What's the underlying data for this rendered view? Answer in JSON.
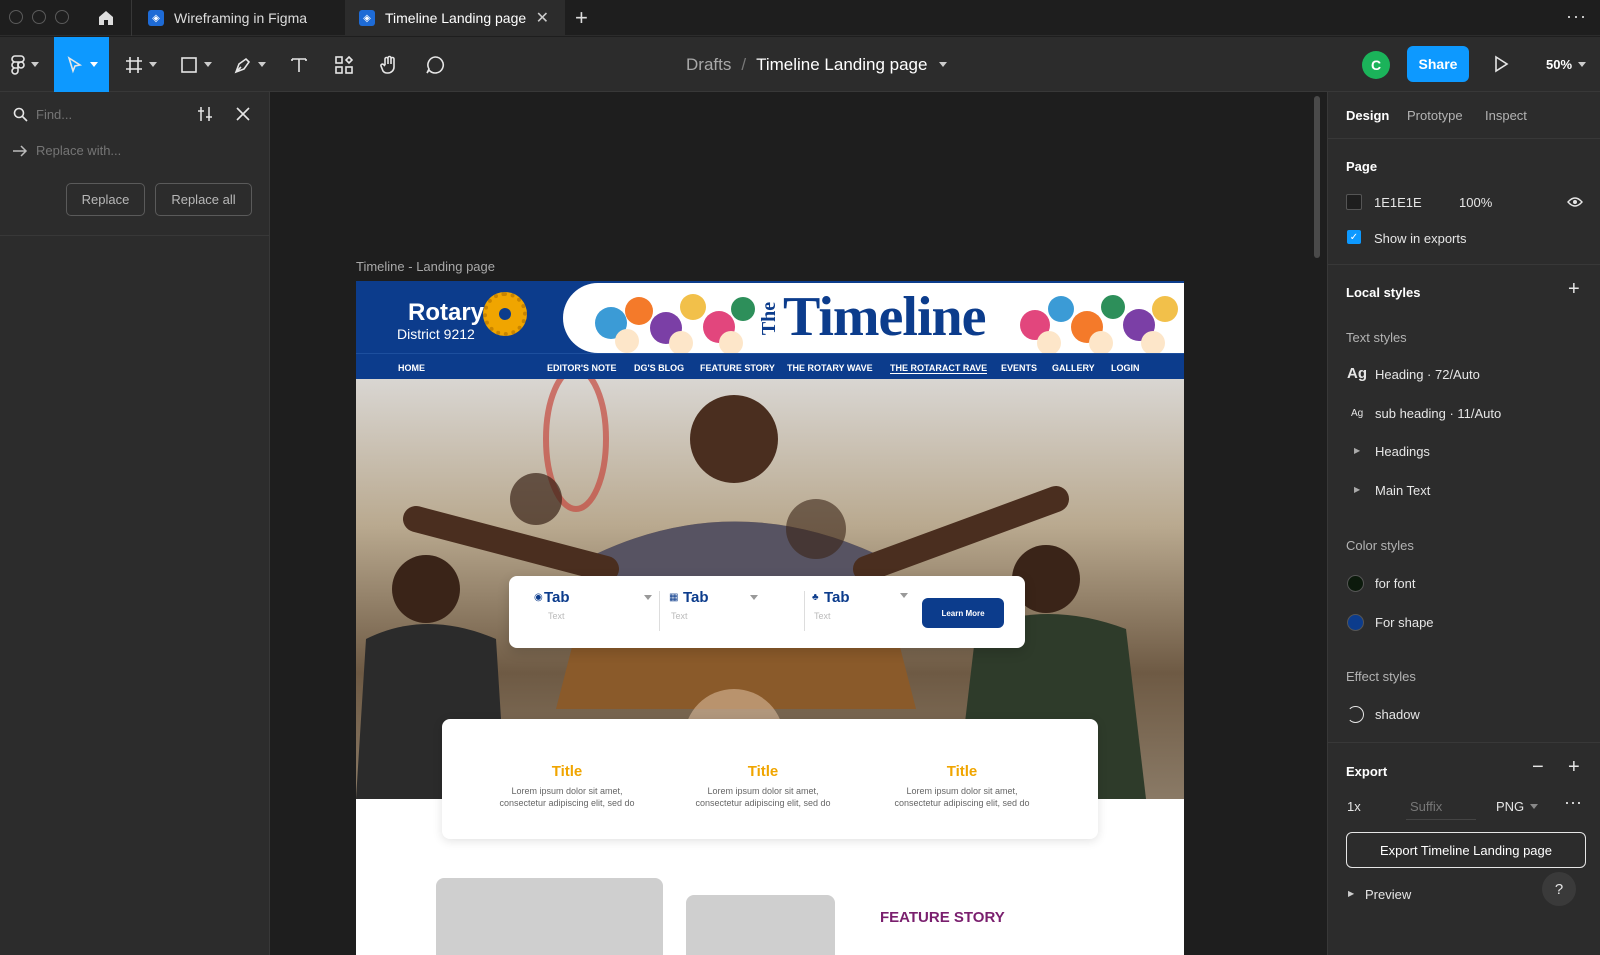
{
  "tabs": [
    {
      "label": "Wireframing in Figma"
    },
    {
      "label": "Timeline Landing page"
    }
  ],
  "toolbar": {
    "breadcrumb_root": "Drafts",
    "breadcrumb_sep": "/",
    "file_name": "Timeline Landing page",
    "avatar_initial": "C",
    "share_label": "Share",
    "zoom": "50%"
  },
  "find": {
    "find_placeholder": "Find...",
    "replace_placeholder": "Replace with...",
    "replace_label": "Replace",
    "replace_all_label": "Replace all"
  },
  "right": {
    "tabs": [
      "Design",
      "Prototype",
      "Inspect"
    ],
    "page_heading": "Page",
    "page_color": "1E1E1E",
    "page_opacity": "100%",
    "show_exports": "Show in exports",
    "local_styles": "Local styles",
    "text_styles": "Text styles",
    "text_items": [
      {
        "icon": "Ag",
        "name": "Heading · 72/Auto"
      },
      {
        "icon": "Ag",
        "name": "sub heading · 11/Auto"
      }
    ],
    "groups": [
      "Headings",
      "Main Text"
    ],
    "color_styles": "Color styles",
    "colors": [
      {
        "name": "for font",
        "hex": "#0c1a0c"
      },
      {
        "name": "For shape",
        "hex": "#0c3c8c"
      }
    ],
    "effect_styles": "Effect styles",
    "effect": "shadow",
    "export_heading": "Export",
    "export_scale": "1x",
    "export_suffix": "Suffix",
    "export_format": "PNG",
    "export_button": "Export Timeline Landing page",
    "preview": "Preview",
    "help": "?"
  },
  "frame": {
    "label": "Timeline - Landing page",
    "rotary": "Rotary",
    "district": "District 9212",
    "masthead_the": "The",
    "masthead_title": "Timeline",
    "nav": [
      "HOME",
      "EDITOR'S NOTE",
      "DG'S BLOG",
      "FEATURE STORY",
      "THE ROTARY WAVE",
      "THE ROTARACT RAVE",
      "EVENTS",
      "GALLERY",
      "LOGIN"
    ],
    "search_tabs": [
      {
        "label": "Tab",
        "sub": "Text"
      },
      {
        "label": "Tab",
        "sub": "Text"
      },
      {
        "label": "Tab",
        "sub": "Text"
      }
    ],
    "learn_more": "Learn More",
    "cards": [
      {
        "title": "Title",
        "line1": "Lorem ipsum dolor sit amet,",
        "line2": "consectetur adipiscing elit, sed do"
      },
      {
        "title": "Title",
        "line1": "Lorem ipsum dolor sit amet,",
        "line2": "consectetur adipiscing elit, sed do"
      },
      {
        "title": "Title",
        "line1": "Lorem ipsum dolor sit amet,",
        "line2": "consectetur adipiscing elit, sed do"
      }
    ],
    "feature_story": "FEATURE STORY"
  },
  "colors": {
    "accent": "#0d99ff",
    "rotary_blue": "#0c3c8c",
    "gold": "#f0a500",
    "feature_purple": "#7a1f6e"
  }
}
